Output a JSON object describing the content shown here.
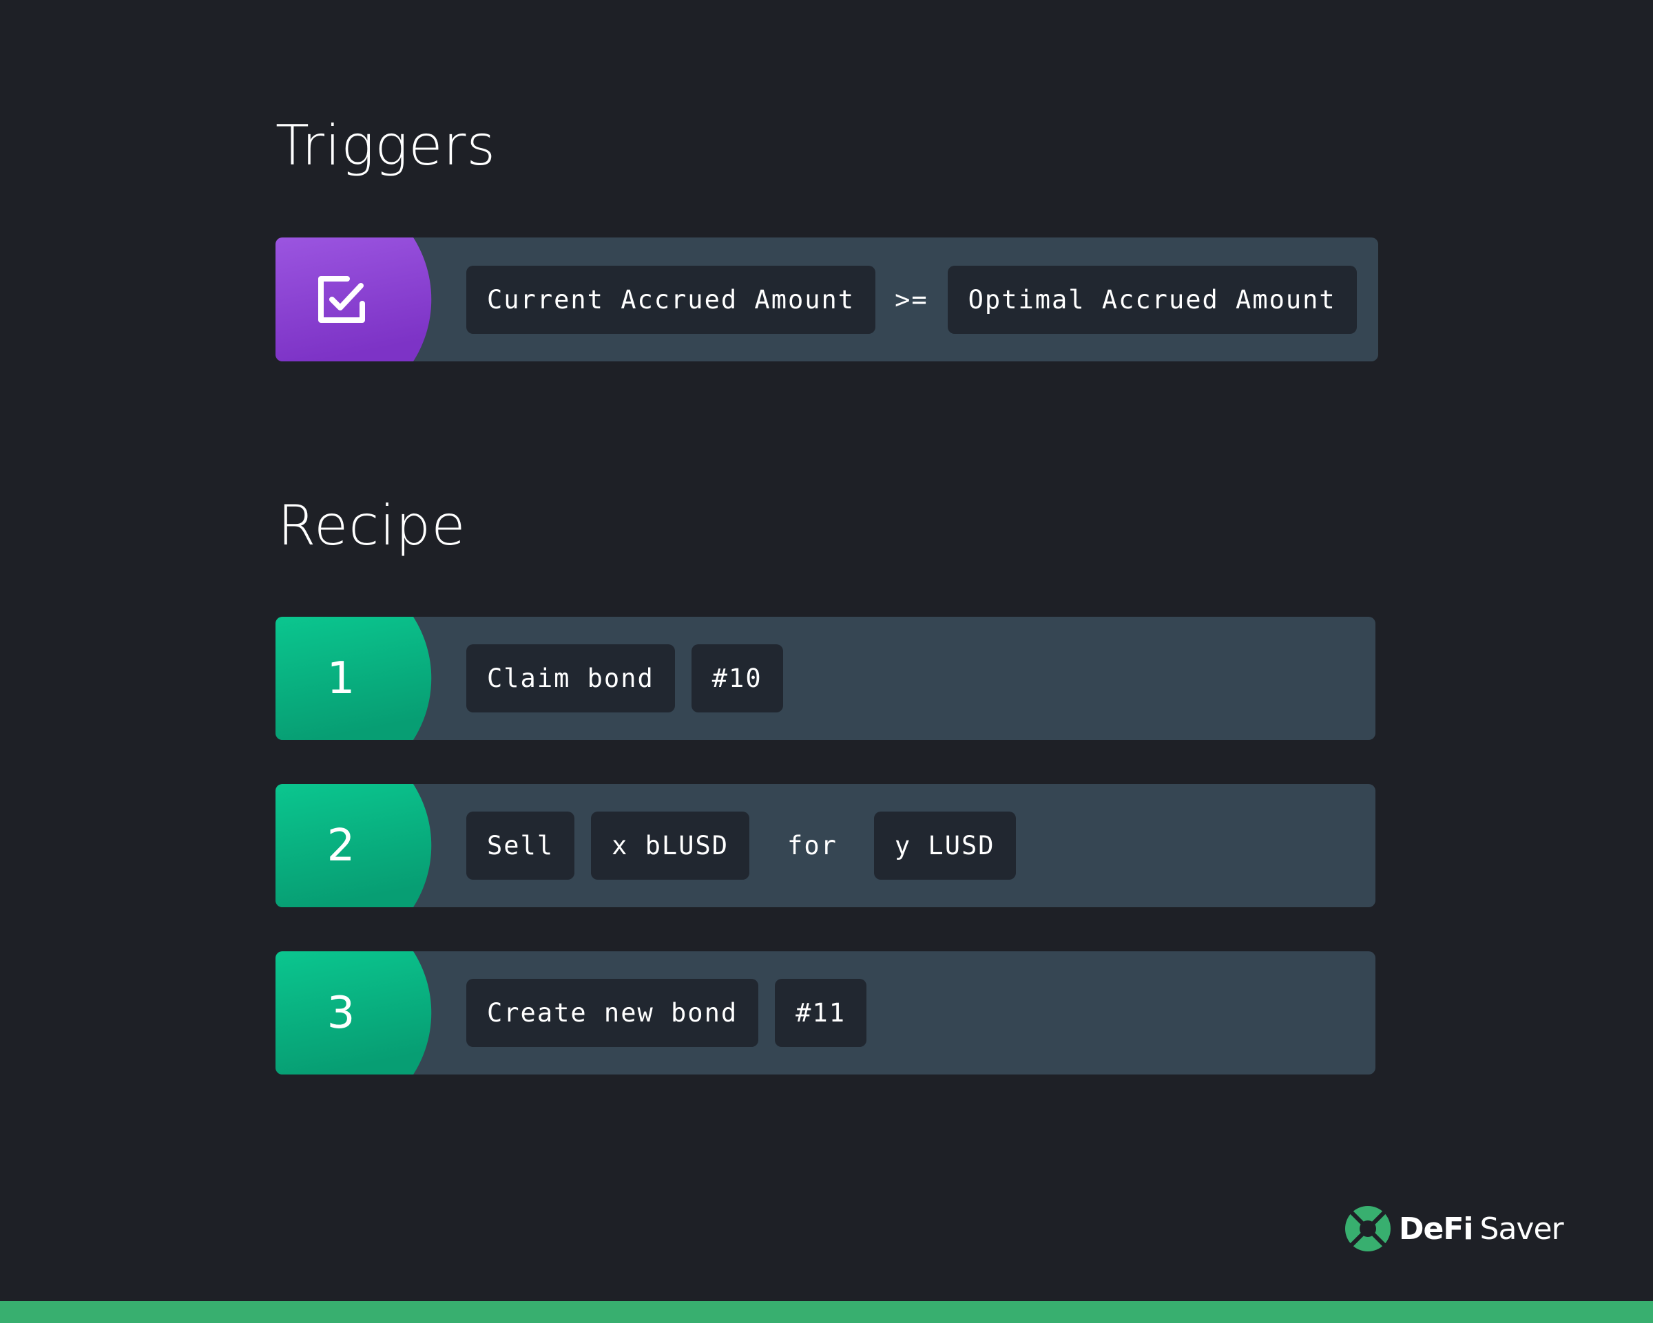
{
  "colors": {
    "background": "#1e2026",
    "row": "#364653",
    "pill": "#212730",
    "trigger_accent_top": "#9b55e0",
    "trigger_accent_bottom": "#7d33c6",
    "recipe_accent_top": "#0bc68f",
    "recipe_accent_bottom": "#079e73",
    "brand_green": "#38af6f"
  },
  "triggers": {
    "title": "Triggers",
    "items": [
      {
        "icon": "checkbox-checked-icon",
        "left": "Current Accrued Amount",
        "operator": ">=",
        "right": "Optimal Accrued Amount"
      }
    ]
  },
  "recipe": {
    "title": "Recipe",
    "steps": [
      {
        "number": "1",
        "parts": [
          "Claim bond",
          "#10"
        ]
      },
      {
        "number": "2",
        "parts": [
          "Sell",
          "x bLUSD",
          "for",
          "y LUSD"
        ]
      },
      {
        "number": "3",
        "parts": [
          "Create new bond",
          "#11"
        ]
      }
    ]
  },
  "brand": {
    "icon": "lifebuoy-icon",
    "name_bold": "DeFi",
    "name_light": "Saver"
  }
}
